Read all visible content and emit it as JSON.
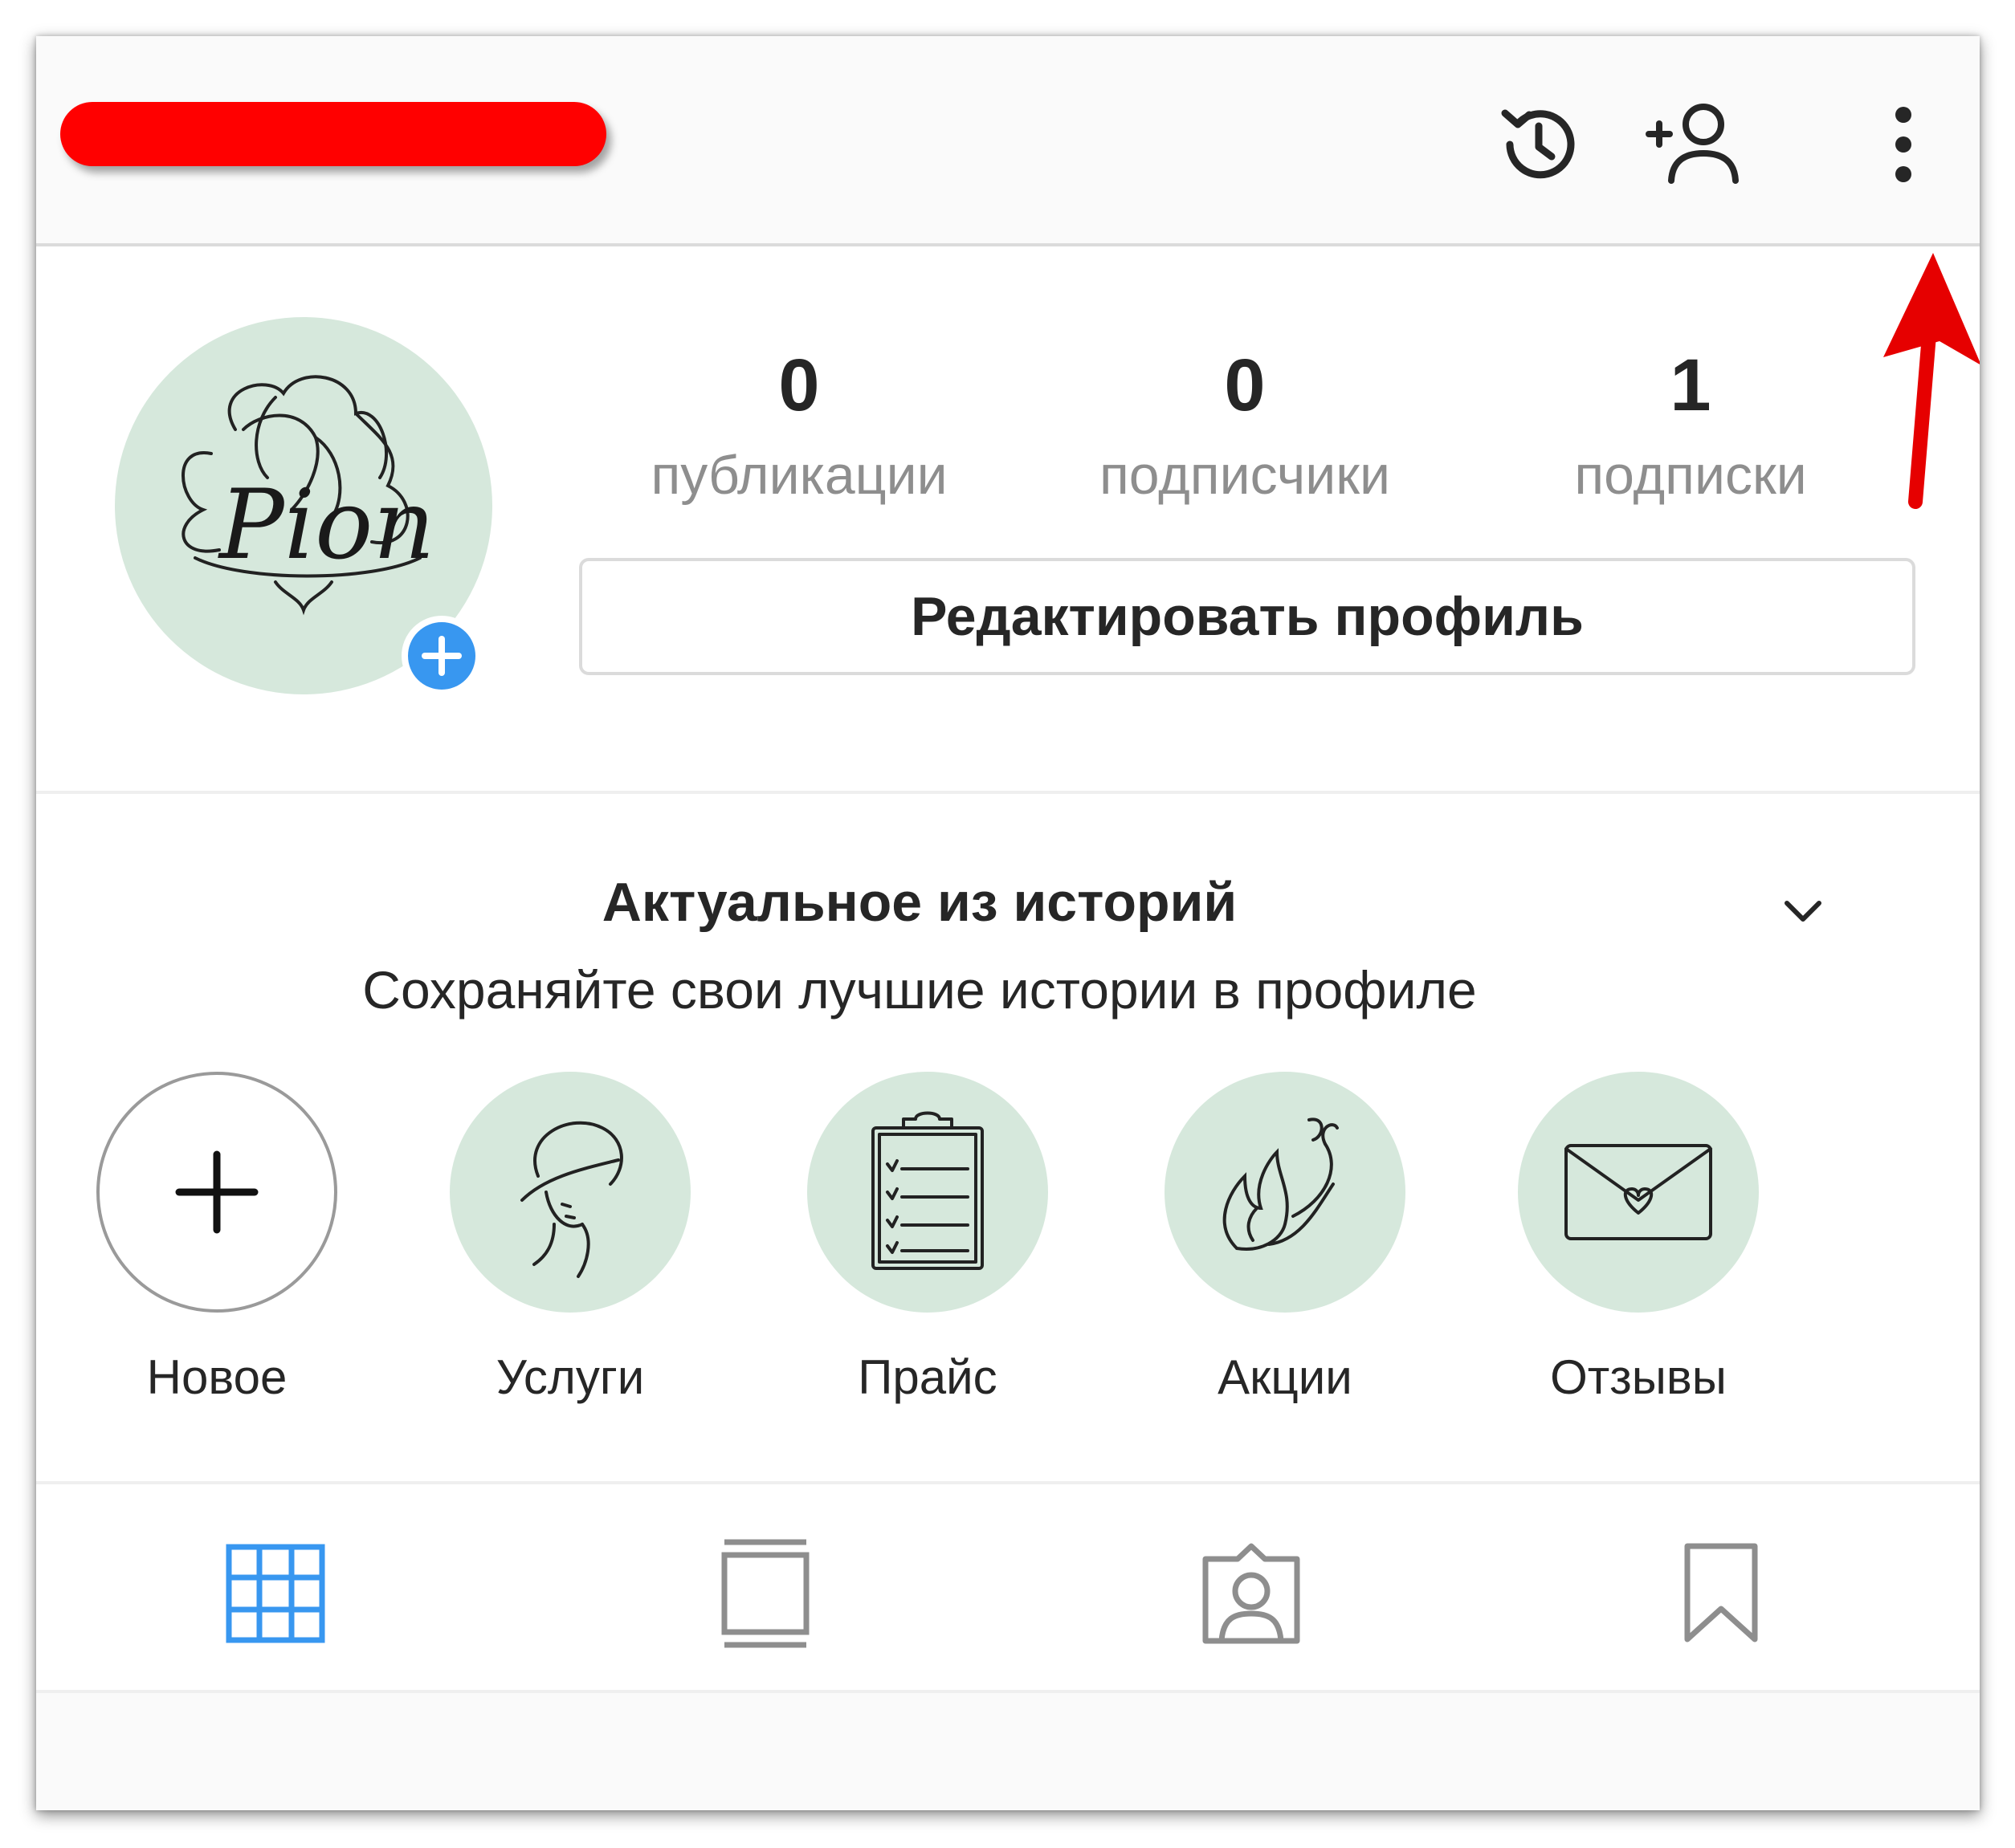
{
  "header": {
    "username_redacted": true,
    "icons": [
      "history-icon",
      "add-person-icon",
      "more-vertical-icon"
    ]
  },
  "profile": {
    "avatar_text": "Pion",
    "stats": [
      {
        "value": "0",
        "label": "публикации"
      },
      {
        "value": "0",
        "label": "подписчики"
      },
      {
        "value": "1",
        "label": "подписки"
      }
    ],
    "edit_button": "Редактировать профиль"
  },
  "highlights": {
    "title": "Актуальное из историй",
    "subtitle": "Сохраняйте свои лучшие истории в профиле",
    "items": [
      {
        "label": "Новое",
        "icon": "plus-icon"
      },
      {
        "label": "Услуги",
        "icon": "woman-face-icon"
      },
      {
        "label": "Прайс",
        "icon": "clipboard-icon"
      },
      {
        "label": "Акции",
        "icon": "flame-icon"
      },
      {
        "label": "Отзывы",
        "icon": "envelope-heart-icon"
      }
    ]
  },
  "tabs": [
    "grid-icon",
    "feed-icon",
    "tagged-icon",
    "saved-icon"
  ],
  "colors": {
    "accent_blue": "#3897f0",
    "highlight_bg": "#d6e8dc",
    "annotation_red": "#ff0000"
  }
}
